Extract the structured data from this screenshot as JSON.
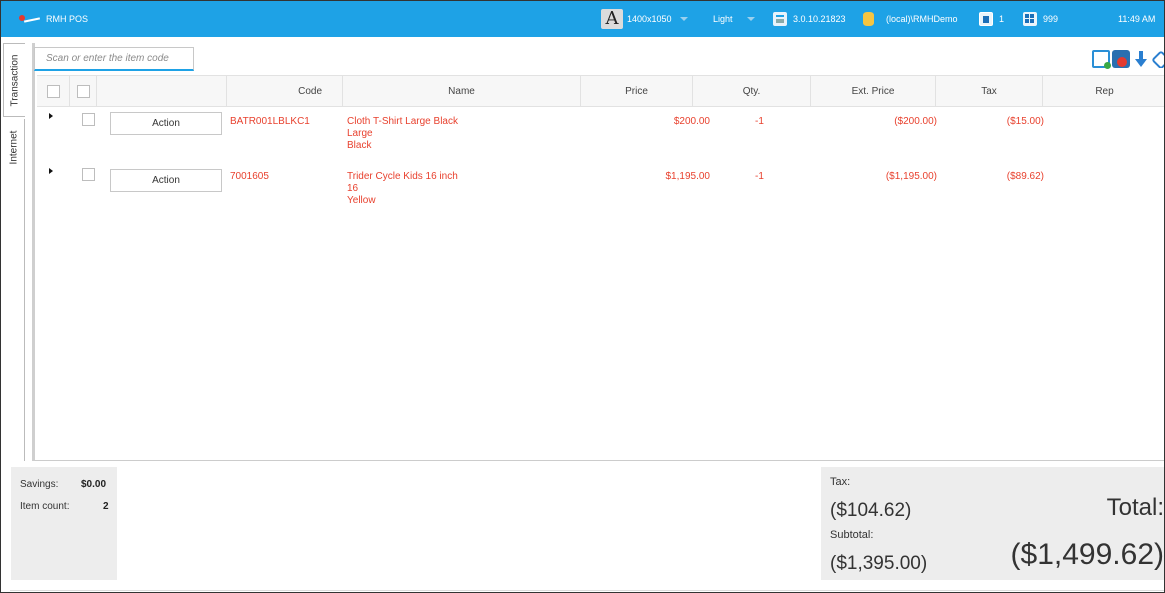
{
  "app": {
    "title": "RMH POS"
  },
  "topbar": {
    "resolution": "1400x1050",
    "theme": "Light",
    "version": "3.0.10.21823",
    "database": "(local)\\RMHDemo",
    "register": "1",
    "store": "999",
    "time": "11:49 AM",
    "font_glyph": "A"
  },
  "side_tabs": {
    "transaction": "Transaction",
    "internet": "Internet"
  },
  "search": {
    "placeholder": "Scan or enter the item code",
    "value": ""
  },
  "toolbar_icons": [
    "cart-icon",
    "bag-icon",
    "download-arrow-icon",
    "edit-icon"
  ],
  "grid": {
    "columns": [
      "Code",
      "Name",
      "Price",
      "Qty.",
      "Ext. Price",
      "Tax",
      "Rep"
    ],
    "rows": [
      {
        "code": "BATR001LBLKC1",
        "name_lines": [
          "Cloth T-Shirt Large Black",
          "Large",
          "Black"
        ],
        "price": "$200.00",
        "qty": "-1",
        "ext_price": "($200.00)",
        "tax": "($15.00)",
        "rep": "",
        "action": "Action"
      },
      {
        "code": "7001605",
        "name_lines": [
          "Trider Cycle Kids 16 inch",
          "16",
          "Yellow"
        ],
        "price": "$1,195.00",
        "qty": "-1",
        "ext_price": "($1,195.00)",
        "tax": "($89.62)",
        "rep": "",
        "action": "Action"
      }
    ]
  },
  "summary": {
    "savings_label": "Savings:",
    "savings_value": "$0.00",
    "item_count_label": "Item count:",
    "item_count_value": "2"
  },
  "totals": {
    "tax_label": "Tax:",
    "tax_value": "($104.62)",
    "subtotal_label": "Subtotal:",
    "subtotal_value": "($1,395.00)",
    "total_label": "Total:",
    "total_value": "($1,499.62)"
  },
  "colors": {
    "topbar": "#1ea2e6",
    "row_text": "#e8412e"
  }
}
